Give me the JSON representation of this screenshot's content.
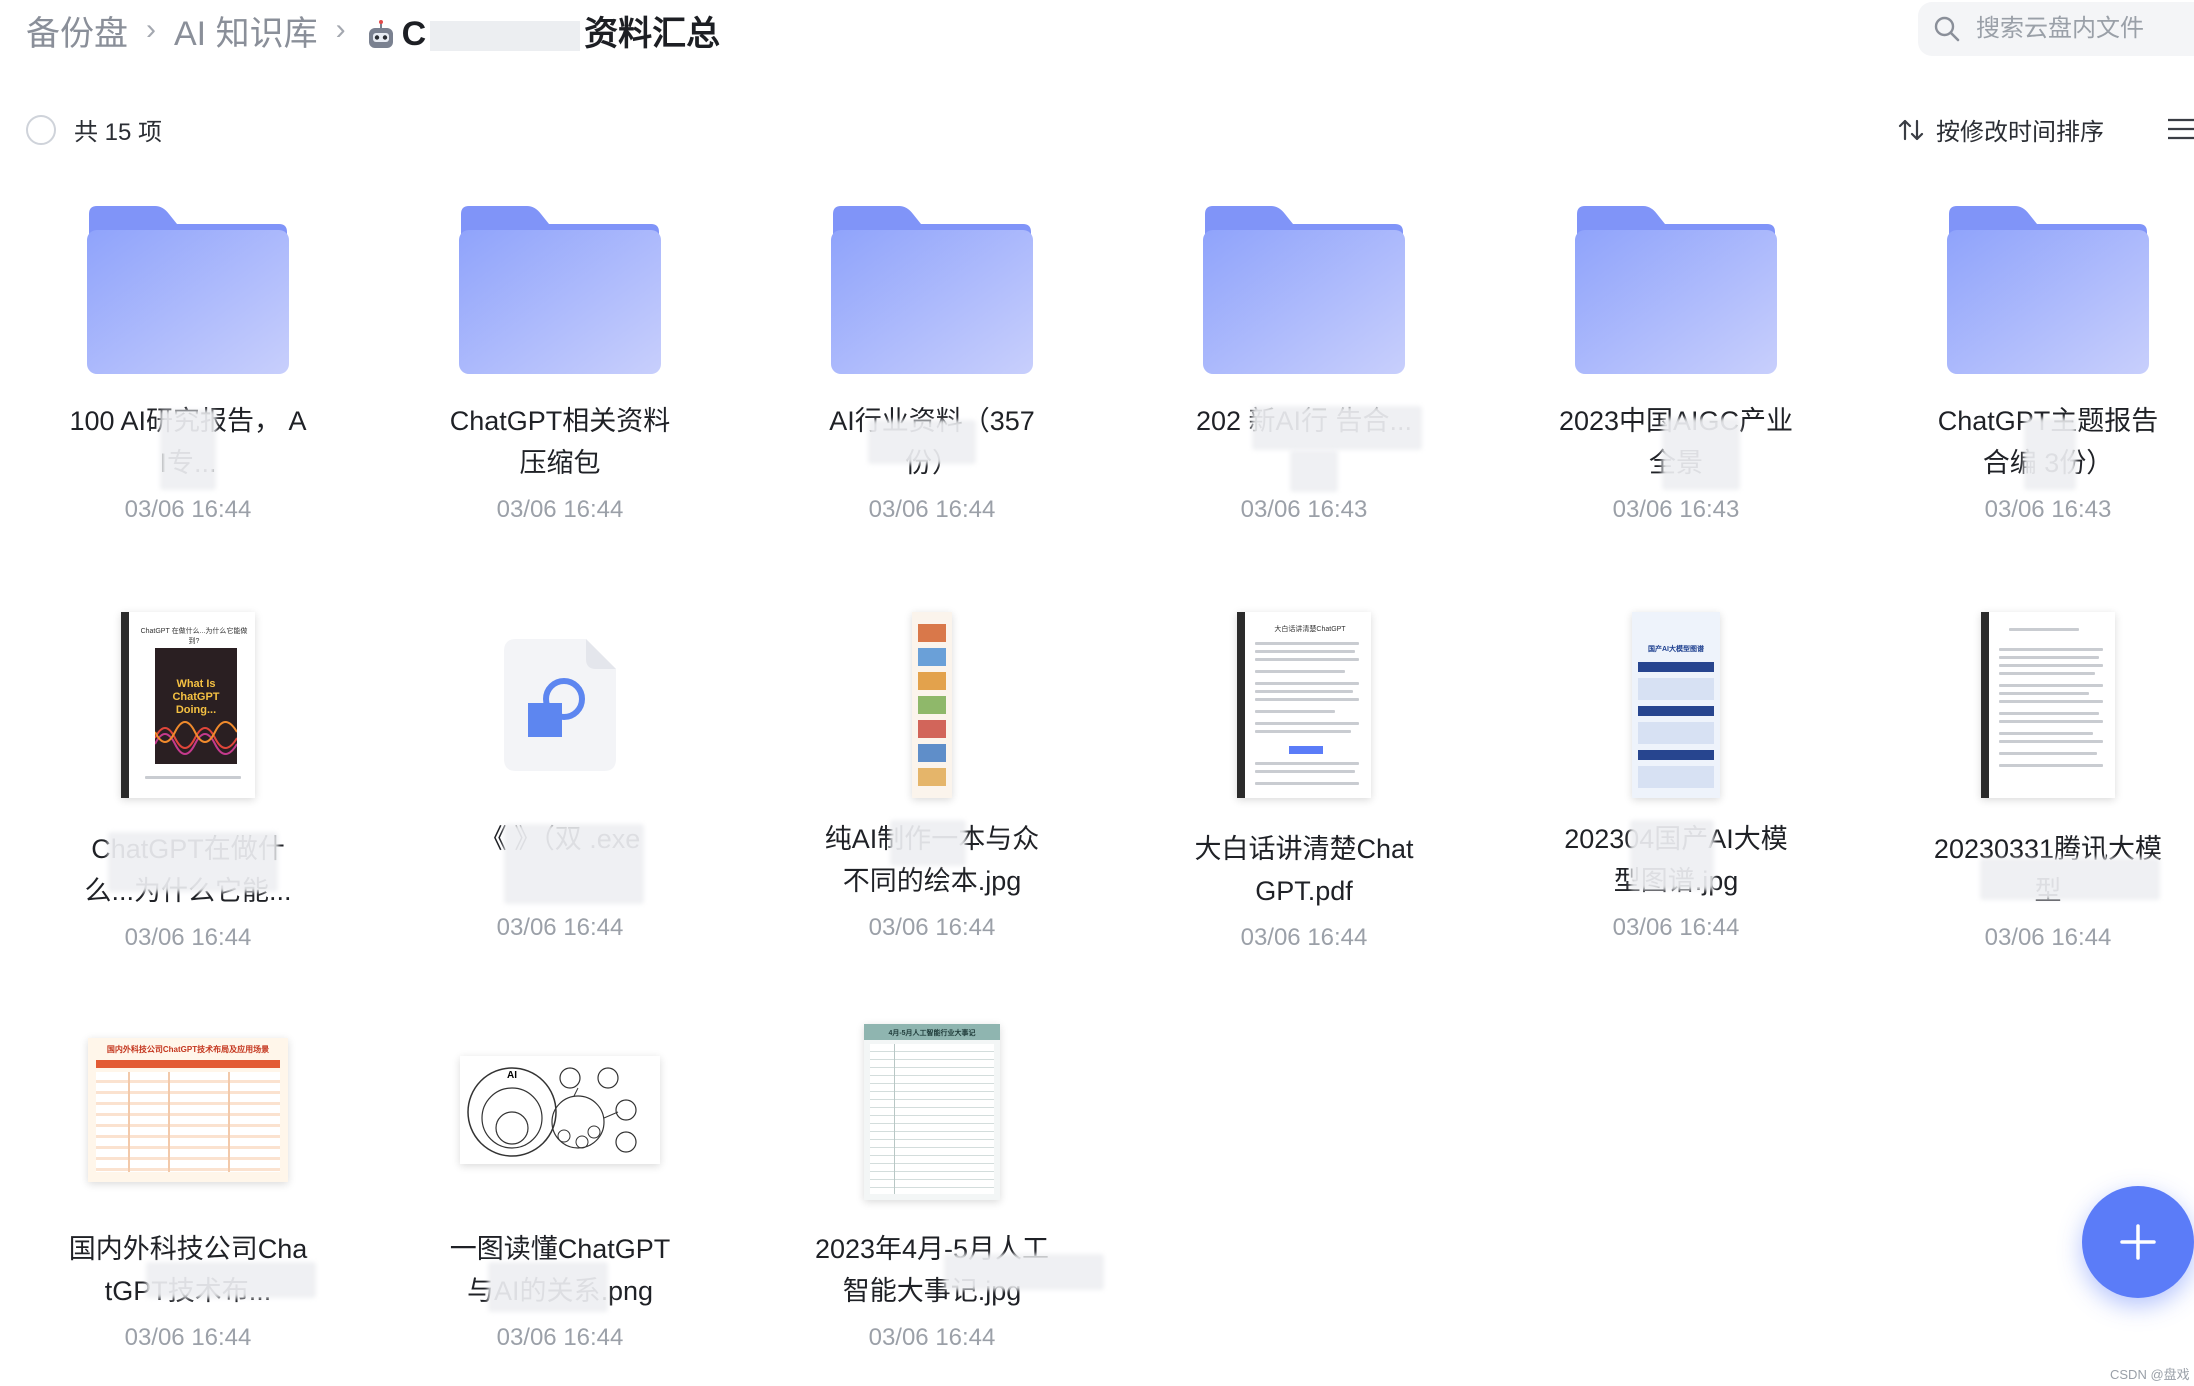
{
  "breadcrumb": {
    "root": "备份盘",
    "level1": "AI 知识库",
    "current_prefix": "C",
    "current_suffix": "资料汇总"
  },
  "search": {
    "placeholder": "搜索云盘内文件"
  },
  "toolbar": {
    "count_label": "共 15 项",
    "sort_label": "按修改时间排序"
  },
  "items": [
    {
      "name": "100  AI研究报告，  AI专...",
      "date": "03/06 16:44",
      "type": "folder"
    },
    {
      "name": "ChatGPT相关资料压缩包",
      "date": "03/06 16:44",
      "type": "folder"
    },
    {
      "name": "AI行业资料（357份）",
      "date": "03/06 16:44",
      "type": "folder"
    },
    {
      "name": "202  新AI行  告合...",
      "date": "03/06 16:43",
      "type": "folder"
    },
    {
      "name": "2023中国AIGC产业全景",
      "date": "03/06 16:43",
      "type": "folder"
    },
    {
      "name": "ChatGPT主题报告合编  3份）",
      "date": "03/06 16:43",
      "type": "folder"
    },
    {
      "name": "ChatGPT在做什么...为什么它能...",
      "date": "03/06 16:44",
      "type": "pdf"
    },
    {
      "name": "《  》（双  .exe",
      "date": "03/06 16:44",
      "type": "exe"
    },
    {
      "name": "纯AI制作一本与众不同的绘本.jpg",
      "date": "03/06 16:44",
      "type": "jpg"
    },
    {
      "name": "大白话讲清楚ChatGPT.pdf",
      "date": "03/06 16:44",
      "type": "pdf"
    },
    {
      "name": "202304国产AI大模型图谱.jpg",
      "date": "03/06 16:44",
      "type": "jpg"
    },
    {
      "name": "20230331腾讯大模型",
      "date": "03/06 16:44",
      "type": "pdf"
    },
    {
      "name": "国内外科技公司ChatGPT技术布...",
      "date": "03/06 16:44",
      "type": "jpg"
    },
    {
      "name": "一图读懂ChatGPT与AI的关系.png",
      "date": "03/06 16:44",
      "type": "png"
    },
    {
      "name": "2023年4月-5月人工智能大事记.jpg",
      "date": "03/06 16:44",
      "type": "jpg"
    }
  ],
  "thumb_text": {
    "book_title": "ChatGPT 在做什么...为什么它能做到?",
    "book_cover": "What Is ChatGPT Doing...",
    "doc10_title": "大白话讲清楚ChatGPT",
    "map_title": "国产AI大模型图谱",
    "tech_title": "国内外科技公司ChatGPT技术布局及应用场景",
    "ai_label": "AI",
    "events_title": "4月-5月人工智能行业大事记"
  },
  "watermark": "CSDN @盘戏",
  "colors": {
    "folder_top": "#8ea2fb",
    "folder_body": "#aab8fb",
    "accent": "#5b7cf8"
  }
}
